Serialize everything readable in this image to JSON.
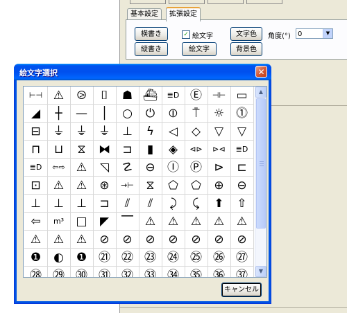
{
  "background_window": {
    "tabs": [
      {
        "label": "基本設定",
        "active": false
      },
      {
        "label": "拡張設定",
        "active": true
      }
    ],
    "buttons": {
      "horizontal_label": "横書き",
      "vertical_label": "縦書き",
      "emoji_label": "絵文字",
      "text_color_label": "文字色",
      "bg_color_label": "背景色"
    },
    "checkbox": {
      "label": "絵文字",
      "checked": true
    },
    "angle": {
      "label": "角度(°)",
      "value": "0"
    }
  },
  "dialog": {
    "title": "絵文字選択",
    "cancel_label": "キャンセル",
    "symbols": [
      [
        "⊢⊣",
        "⚠",
        "⧁",
        "⌷",
        "☗",
        "⛴",
        "≣D",
        "Ⓔ",
        "⊣⊢",
        "▭"
      ],
      [
        "◢",
        "┼",
        "—",
        "│",
        "○",
        "⏻",
        "⦶",
        "⍑",
        "☼",
        "⓵"
      ],
      [
        "⊟",
        "⏚",
        "⏚",
        "⏚",
        "⊥",
        "ϟ",
        "◁",
        "◇",
        "▽",
        "▽"
      ],
      [
        "⊓",
        "⊔",
        "⧖",
        "⧓",
        "⊐",
        "▮",
        "◈",
        "⊲⊳",
        "⊳⊲",
        "≣D"
      ],
      [
        "≣D",
        "⇦⇨",
        "⚠",
        "◹",
        "☡",
        "⊖",
        "Ⓘ",
        "Ⓟ",
        "⊳",
        "⊏"
      ],
      [
        "⊡",
        "⚠",
        "⚠",
        "⊛",
        "→⊢",
        "⧖",
        "⬠",
        "⬠",
        "⊕",
        "⊖"
      ],
      [
        "⊥",
        "⊥",
        "⊥",
        "⊐",
        "⫽",
        "⫽",
        "⤸",
        "⤹",
        "⬆",
        "⇧"
      ],
      [
        "⇦",
        "m³",
        "□",
        "◤",
        "⎺",
        "⚠",
        "⚠",
        "⚠",
        "⚠",
        "⚠"
      ],
      [
        "⚠",
        "⚠",
        "⚠",
        "⊘",
        "⊘",
        "⊘",
        "⊘",
        "⊘",
        "⊘",
        "⊘"
      ],
      [
        "❶",
        "◐",
        "❶",
        "㉑",
        "㉒",
        "㉓",
        "㉔",
        "㉕",
        "㉖",
        "㉗"
      ],
      [
        "㉘",
        "㉙",
        "㉚",
        "㉛",
        "㉜",
        "㉝",
        "㉞",
        "㉟",
        "㊱",
        "㊲"
      ]
    ]
  }
}
